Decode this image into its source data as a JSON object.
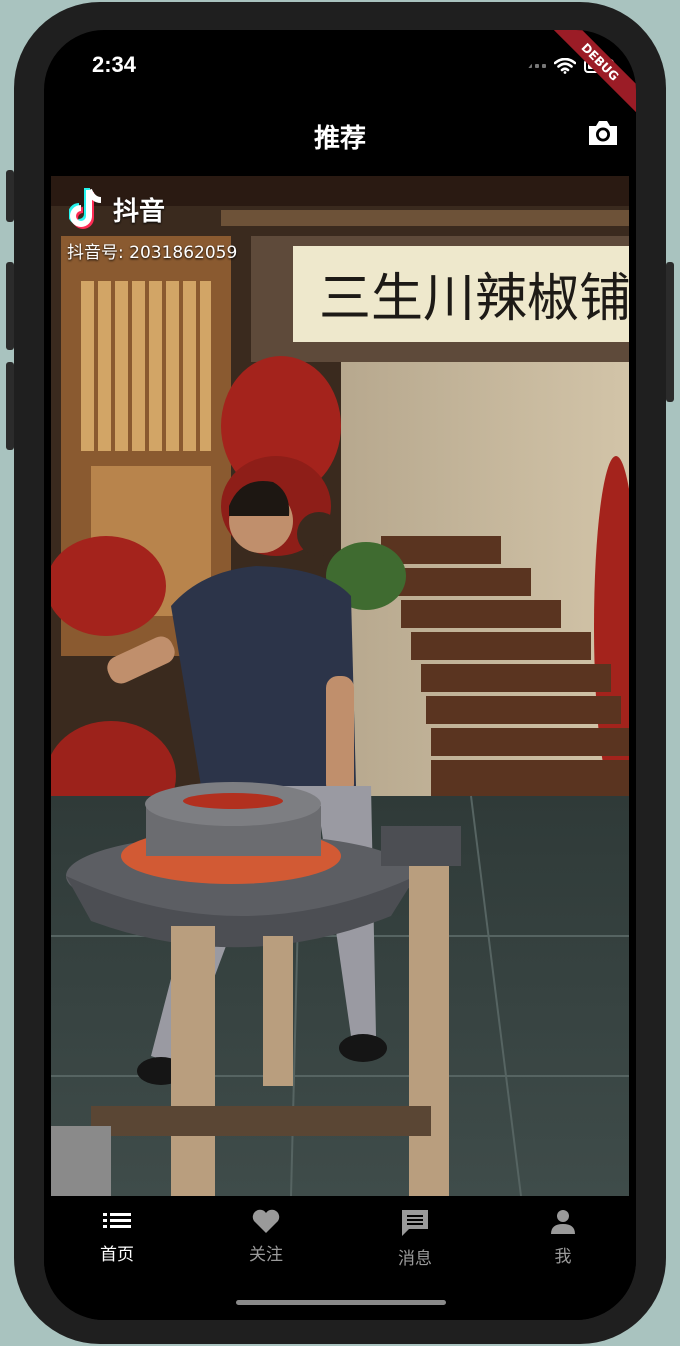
{
  "status_bar": {
    "time": "2:34"
  },
  "debug_banner": "DEBUG",
  "header": {
    "title": "推荐",
    "camera_icon": "camera-icon"
  },
  "video": {
    "watermark_logo": "抖音",
    "watermark_id": "抖音号: 2031862059",
    "sign_text": "三生川辣椒铺"
  },
  "tabs": [
    {
      "label": "首页",
      "icon": "list-icon",
      "active": true
    },
    {
      "label": "关注",
      "icon": "heart-icon",
      "active": false
    },
    {
      "label": "消息",
      "icon": "message-icon",
      "active": false
    },
    {
      "label": "我",
      "icon": "person-icon",
      "active": false
    }
  ],
  "colors": {
    "active_tab": "#ffffff",
    "inactive_tab": "#9a9a9a",
    "debug_banner": "#9b1c26"
  }
}
